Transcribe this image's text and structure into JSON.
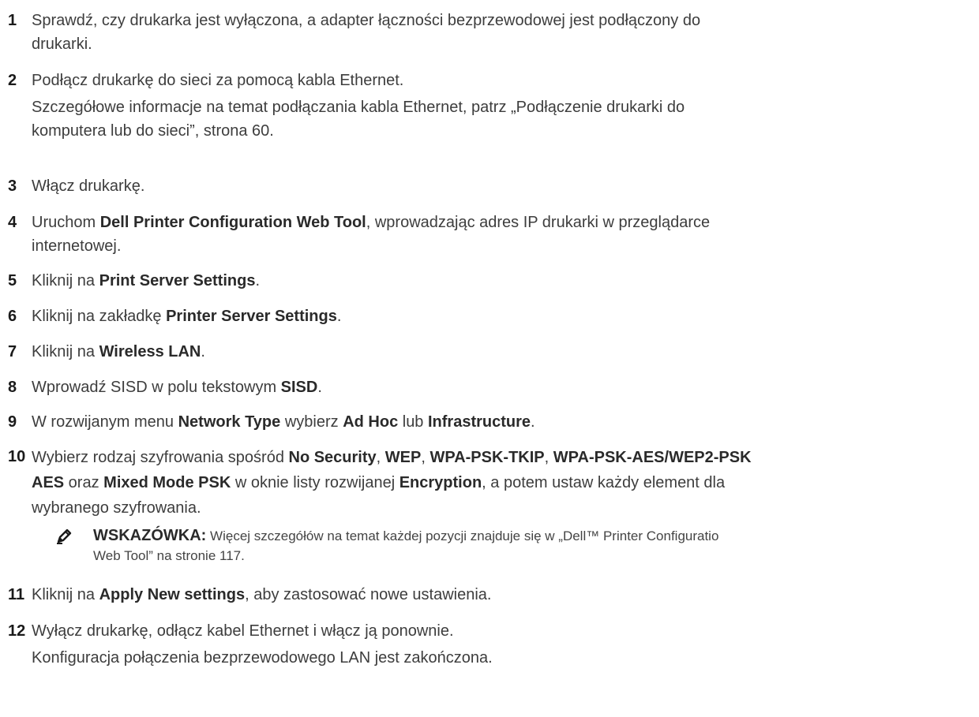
{
  "steps": [
    {
      "num": "1",
      "lines": [
        "Sprawdź, czy drukarka jest wyłączona, a adapter łączności bezprzewodowej jest podłączony do",
        "drukarki."
      ]
    },
    {
      "num": "2",
      "line1": "Podłącz drukarkę do sieci za pomocą kabla Ethernet.",
      "sub": [
        "Szczegółowe informacje na temat podłączania kabla Ethernet, patrz „Podłączenie drukarki do",
        "komputera lub do sieci”, strona 60."
      ]
    },
    {
      "num": "3",
      "text": "Włącz drukarkę."
    },
    {
      "num": "4",
      "pre": "Uruchom ",
      "bold": "Dell Printer Configuration Web Tool",
      "post": ", wprowadzając adres IP drukarki w przeglądarce",
      "line2": "internetowej."
    },
    {
      "num": "5",
      "pre": "Kliknij na ",
      "bold": "Print Server Settings",
      "post": "."
    },
    {
      "num": "6",
      "pre": "Kliknij na zakładkę ",
      "bold": "Printer Server Settings",
      "post": "."
    },
    {
      "num": "7",
      "pre": "Kliknij na ",
      "bold": "Wireless LAN",
      "post": "."
    },
    {
      "num": "8",
      "pre": "Wprowadź SISD w polu tekstowym ",
      "bold": "SISD",
      "post": "."
    },
    {
      "num": "9",
      "pre": "W rozwijanym menu ",
      "bold": "Network Type",
      "mid": " wybierz ",
      "bold2": "Ad Hoc",
      "mid2": " lub ",
      "bold3": "Infrastructure",
      "post": "."
    },
    {
      "num": "10",
      "l1_pre": "Wybierz rodzaj szyfrowania spośród ",
      "l1_b1": "No Security",
      "l1_s1": ", ",
      "l1_b2": "WEP",
      "l1_s2": ", ",
      "l1_b3": "WPA-PSK-TKIP",
      "l1_s3": ", ",
      "l1_b4": "WPA-PSK-AES/WEP2-PSK",
      "l2_b1": "AES",
      "l2_s1": " oraz ",
      "l2_b2": "Mixed Mode PSK",
      "l2_s2": " w oknie listy rozwijanej ",
      "l2_b3": "Encryption",
      "l2_s3": ", a potem ustaw każdy element dla",
      "l3": "wybranego szyfrowania."
    },
    {
      "num": "11",
      "pre": "Kliknij na ",
      "bold": "Apply New settings",
      "post": ", aby zastosować nowe ustawienia."
    },
    {
      "num": "12",
      "line1": "Wyłącz drukarkę, odłącz kabel Ethernet i włącz ją ponownie.",
      "line2": "Konfiguracja połączenia bezprzewodowego LAN jest zakończona."
    }
  ],
  "note": {
    "icon": "pencil-note-icon",
    "label": "WSKAZÓWKA:",
    "line1": " Więcej szczegółów na temat każdej pozycji znajduje się w „Dell™ Printer Configuratio",
    "line2": "Web Tool” na stronie 117."
  }
}
